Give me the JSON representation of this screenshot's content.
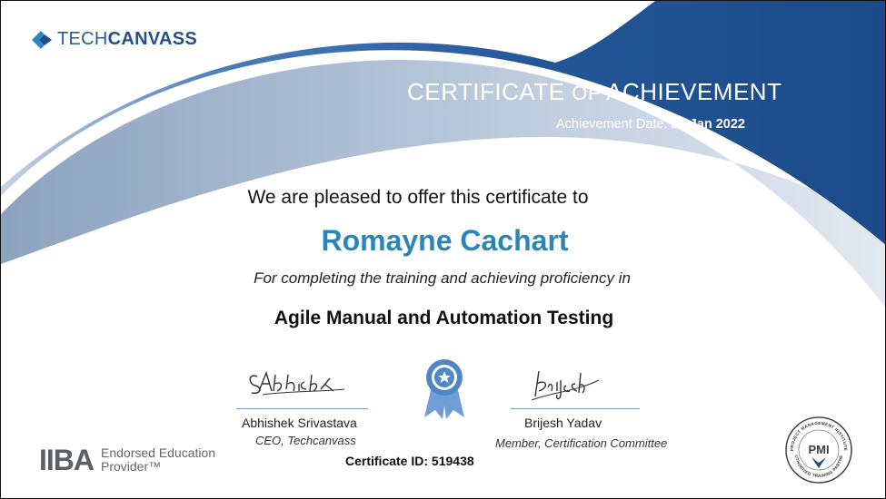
{
  "brand": {
    "name_part1": "TECH",
    "name_part2": "CANVASS"
  },
  "certificate": {
    "title_main1": "CERTIFICATE",
    "title_of": "OF",
    "title_main2": "ACHIEVEMENT",
    "date_label": "Achievement Date:",
    "date_value": "24 Jan 2022"
  },
  "body": {
    "intro": "We are pleased to offer this certificate to",
    "recipient": "Romayne Cachart",
    "completion": "For completing the training and achieving proficiency in",
    "course": "Agile Manual and Automation Testing"
  },
  "signatures": {
    "left": {
      "script": "SAbhishek",
      "name": "Abhishek Srivastava",
      "role": "CEO,  Techcanvass"
    },
    "right": {
      "script": "Brijesh",
      "name": "Brijesh Yadav",
      "role": "Member,   Certification  Committee"
    }
  },
  "certificate_id": {
    "label": "Certificate ID:",
    "value": "519438"
  },
  "iiba": {
    "mark": "IIBA",
    "line1": "Endorsed Education",
    "line2": "Provider™"
  },
  "pmi": {
    "center": "PMI",
    "ring_top": "PROJECT MANAGEMENT INSTITUTE",
    "ring_bottom": "AUTHORIZED TRAINING PARTNER"
  },
  "colors": {
    "accent": "#2a86b8",
    "band_dark": "#1d4f8f",
    "band_light": "#a9bfd7"
  }
}
